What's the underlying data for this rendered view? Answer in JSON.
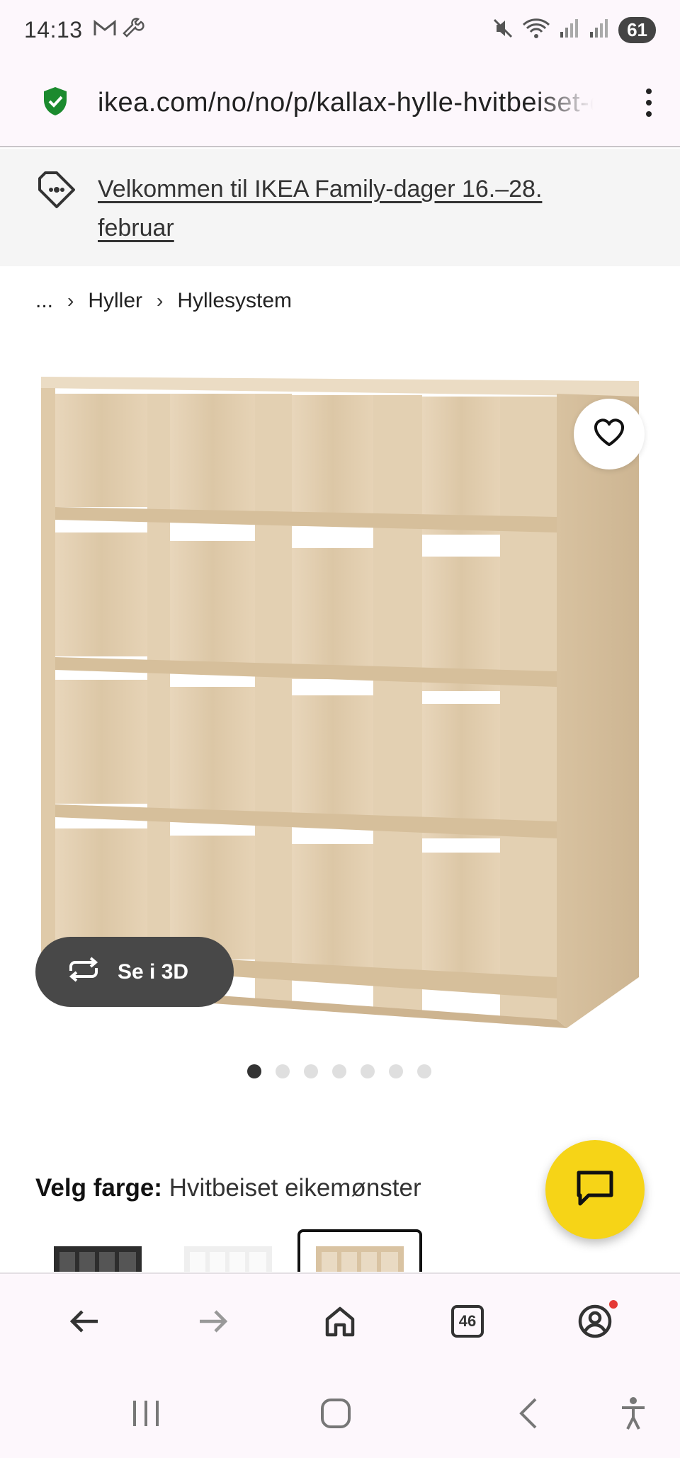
{
  "status_bar": {
    "time": "14:13",
    "battery": "61",
    "left_icons": [
      "gmail-icon",
      "wrench-icon"
    ],
    "right_icons": [
      "mute-icon",
      "wifi-icon",
      "signal-icon",
      "signal-icon"
    ]
  },
  "browser": {
    "url": "ikea.com/no/no/p/kallax-hylle-hvitbeiset-eikemonster",
    "secure_icon": "shield-check-icon",
    "menu_icon": "more-vert-icon"
  },
  "banner": {
    "text": "Velkommen til IKEA Family-dager 16.–28. februar",
    "icon": "price-tag-icon"
  },
  "breadcrumb": {
    "items": [
      "...",
      "Hyller",
      "Hyllesystem"
    ]
  },
  "product": {
    "see_3d_label": "Se i 3D",
    "image_count": 7,
    "active_image": 1
  },
  "color_picker": {
    "label": "Velg farge:",
    "value": "Hvitbeiset eikemønster"
  },
  "bottom_nav": {
    "tab_count": "46"
  },
  "colors": {
    "accent_yellow": "#f6d417",
    "button_dark": "#484848",
    "secure_green": "#1b8a2e",
    "notification_red": "#e53935"
  }
}
